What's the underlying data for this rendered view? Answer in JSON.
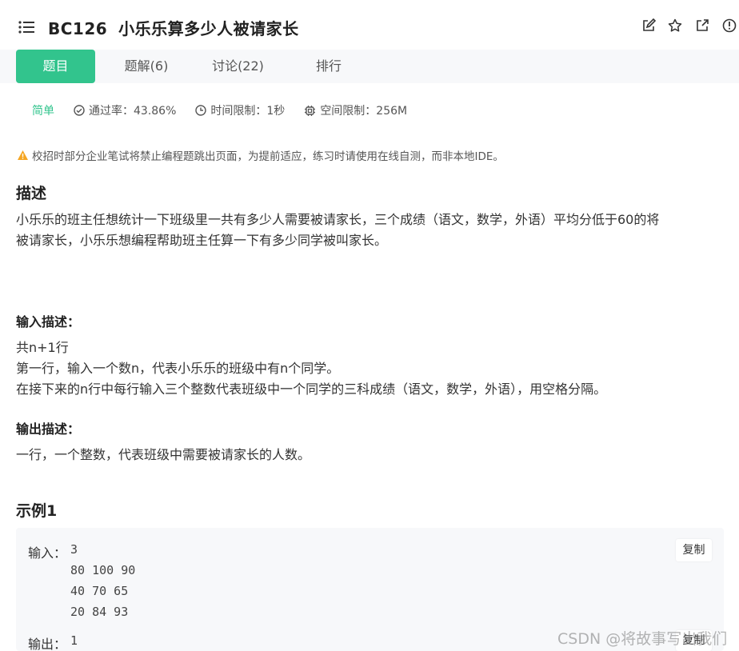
{
  "problem": {
    "id": "BC126",
    "title": "小乐乐算多少人被请家长"
  },
  "header_icons": [
    "edit-icon",
    "star-icon",
    "external-link-icon",
    "info-icon"
  ],
  "tabs": [
    {
      "label": "题目",
      "active": true
    },
    {
      "label": "题解(6)",
      "active": false
    },
    {
      "label": "讨论(22)",
      "active": false
    },
    {
      "label": "排行",
      "active": false
    }
  ],
  "meta": {
    "difficulty": "简单",
    "pass_rate": "通过率：43.86%",
    "time_limit": "时间限制：1秒",
    "space_limit": "空间限制：256M"
  },
  "warning": "校招时部分企业笔试将禁止编程题跳出页面，为提前适应，练习时请使用在线自测，而非本地IDE。",
  "description": {
    "heading": "描述",
    "lines": [
      "小乐乐的班主任想统计一下班级里一共有多少人需要被请家长，三个成绩（语文，数学，外语）平均分低于60的将",
      "被请家长，小乐乐想编程帮助班主任算一下有多少同学被叫家长。"
    ]
  },
  "input_desc": {
    "heading": "输入描述：",
    "lines": [
      "共n+1行",
      "第一行，输入一个数n，代表小乐乐的班级中有n个同学。",
      "在接下来的n行中每行输入三个整数代表班级中一个同学的三科成绩（语文，数学，外语），用空格分隔。"
    ]
  },
  "output_desc": {
    "heading": "输出描述：",
    "lines": [
      "一行，一个整数，代表班级中需要被请家长的人数。"
    ]
  },
  "example": {
    "heading": "示例1",
    "input_label": "输入：",
    "input_lines": [
      "3",
      "80 100 90",
      "40 70 65",
      "20 84 93"
    ],
    "output_label": "输出：",
    "output_lines": [
      "1"
    ],
    "copy_label": "复制"
  },
  "watermark": "CSDN @将故事写出我们",
  "colors": {
    "accent": "#32c48d",
    "warning": "#f5a623",
    "tab_bar_bg": "#f7f8fa"
  }
}
